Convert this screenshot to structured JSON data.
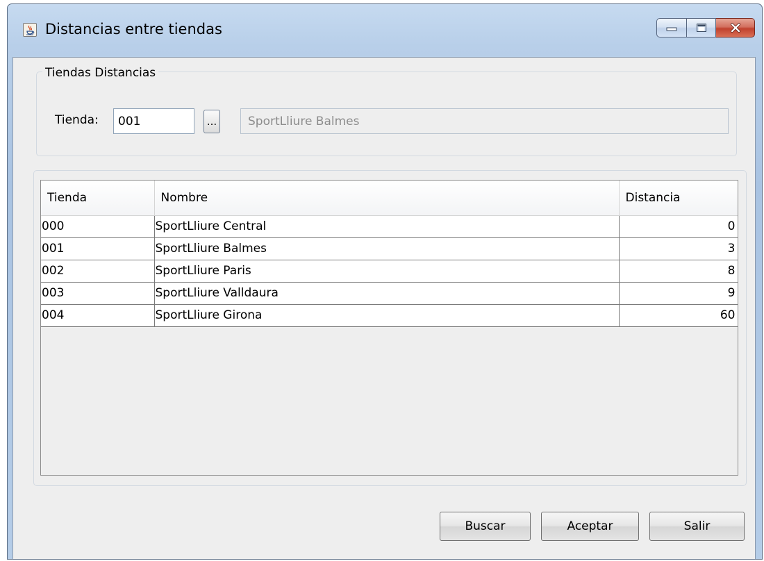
{
  "window": {
    "title": "Distancias entre tiendas",
    "icon": "java-cup-icon",
    "controls": [
      "minimize-icon",
      "maximize-icon",
      "close-icon"
    ]
  },
  "filter": {
    "group_title": "Tiendas Distancias",
    "label": "Tienda:",
    "code_value": "001",
    "lookup_label": "...",
    "name_value": "SportLliure Balmes"
  },
  "table": {
    "columns": [
      "Tienda",
      "Nombre",
      "Distancia"
    ],
    "rows": [
      {
        "tienda": "000",
        "nombre": "SportLliure Central",
        "distancia": "0"
      },
      {
        "tienda": "001",
        "nombre": "SportLliure Balmes",
        "distancia": "3"
      },
      {
        "tienda": "002",
        "nombre": "SportLliure Paris",
        "distancia": "8"
      },
      {
        "tienda": "003",
        "nombre": "SportLliure Valldaura",
        "distancia": "9"
      },
      {
        "tienda": "004",
        "nombre": "SportLliure Girona",
        "distancia": "60"
      }
    ]
  },
  "buttons": {
    "buscar": "Buscar",
    "aceptar": "Aceptar",
    "salir": "Salir"
  }
}
